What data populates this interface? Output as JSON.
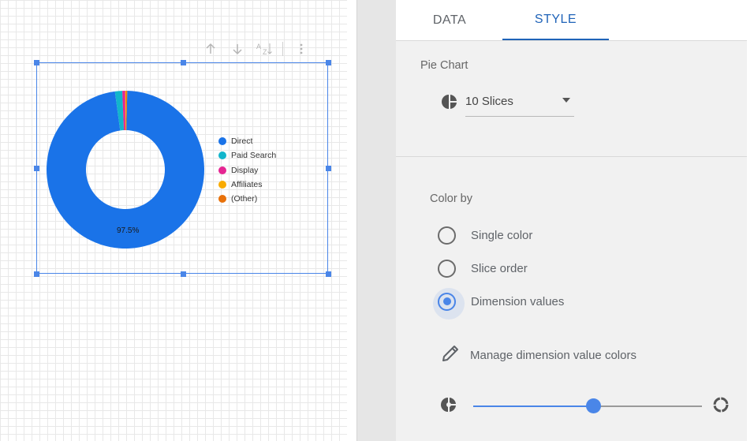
{
  "canvas": {
    "toolbar_icons": [
      "arrow-up-icon",
      "arrow-down-icon",
      "sort-az-icon",
      "more-vert-icon"
    ],
    "chart_data": {
      "type": "pie",
      "style": "donut",
      "labels": [
        "Direct",
        "Paid Search",
        "Display",
        "Affiliates",
        "(Other)"
      ],
      "values": [
        97.5,
        1.5,
        0.6,
        0.2,
        0.2
      ],
      "unit": "%",
      "colors": [
        "#1a73e8",
        "#12b5cb",
        "#e52592",
        "#f9ab00",
        "#e8710a"
      ],
      "data_labels": [
        "97.5%"
      ],
      "legend_position": "right"
    }
  },
  "panel": {
    "tabs": [
      {
        "label": "DATA",
        "active": false
      },
      {
        "label": "STYLE",
        "active": true
      }
    ],
    "pie_chart_title": "Pie Chart",
    "slices_select": {
      "value": "10 Slices",
      "icon": "pie-chart-icon"
    },
    "color_by_title": "Color by",
    "color_options": [
      {
        "label": "Single color",
        "checked": false
      },
      {
        "label": "Slice order",
        "checked": false
      },
      {
        "label": "Dimension values",
        "checked": true
      }
    ],
    "manage_label": "Manage dimension value colors",
    "donut_slider": {
      "value": 0.5,
      "left_icon": "pie-chart-icon",
      "right_icon": "donut-icon"
    },
    "accent_color": "#4a86e8",
    "active_tab_color": "#1f63b8"
  }
}
